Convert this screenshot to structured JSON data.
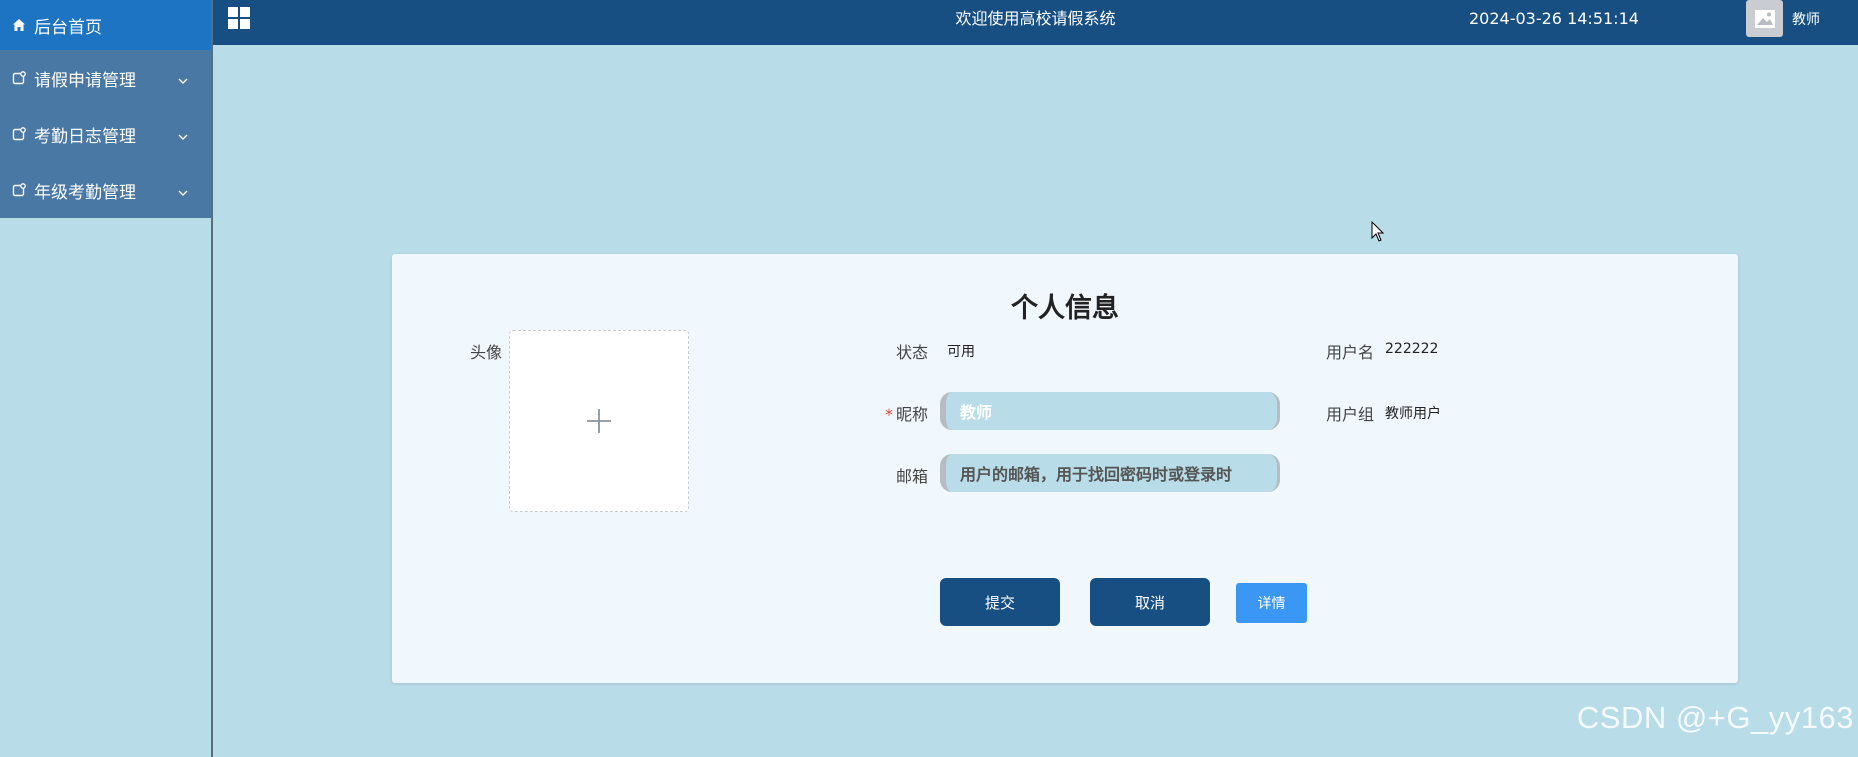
{
  "sidebar": {
    "items": [
      {
        "label": "后台首页",
        "icon": "home-icon"
      },
      {
        "label": "请假申请管理",
        "icon": "menu-doc-icon"
      },
      {
        "label": "考勤日志管理",
        "icon": "menu-doc-icon"
      },
      {
        "label": "年级考勤管理",
        "icon": "menu-doc-icon"
      }
    ]
  },
  "header": {
    "title": "欢迎使用高校请假系统",
    "datetime": "2024-03-26 14:51:14",
    "user": "教师"
  },
  "profile": {
    "title": "个人信息",
    "avatar_label": "头像",
    "status_label": "状态",
    "status_value": "可用",
    "username_label": "用户名",
    "username_value": "222222",
    "nickname_required": "*",
    "nickname_label": "昵称",
    "nickname_value": "教师",
    "usergroup_label": "用户组",
    "usergroup_value": "教师用户",
    "email_label": "邮箱",
    "email_placeholder": "用户的邮箱，用于找回密码时或登录时"
  },
  "actions": {
    "submit": "提交",
    "cancel": "取消",
    "details": "详情"
  },
  "watermark": "CSDN @+G_yy163",
  "colors": {
    "header_bg": "#174f83",
    "sidebar_item_bg": "#4878a3",
    "sidebar_active_bg": "#1c74c2",
    "page_bg": "#b8dce8",
    "card_bg": "#f0f7fd",
    "primary_button": "#174f83",
    "detail_button": "#3a97f4"
  }
}
